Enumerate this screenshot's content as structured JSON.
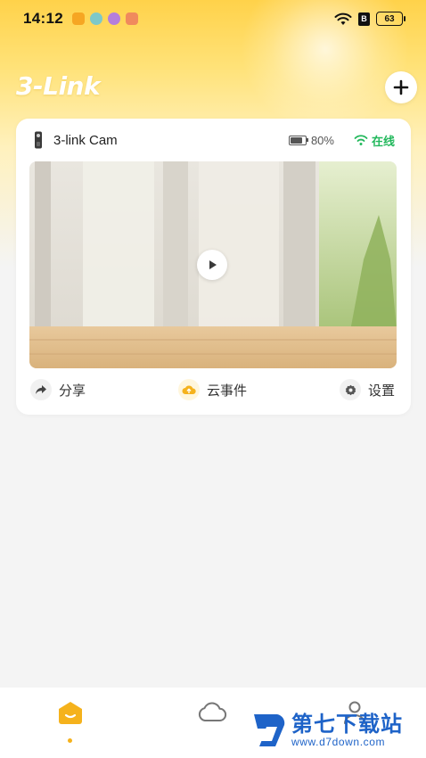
{
  "status_bar": {
    "time": "14:12",
    "battery": "63",
    "notification_icons": [
      "#f6a623",
      "#7ec8c8",
      "#b57edc",
      "#f08a5d"
    ]
  },
  "header": {
    "logo": "3-Link",
    "add_icon": "plus-icon"
  },
  "device": {
    "name": "3-link Cam",
    "battery": "80%",
    "battery_level": 0.8,
    "status": "在线",
    "status_color": "#22b85c"
  },
  "actions": {
    "share": "分享",
    "cloud_events": "云事件",
    "settings": "设置"
  },
  "tabbar": {
    "tabs": [
      "home-icon",
      "cloud-icon",
      "profile-icon"
    ],
    "active": 0,
    "accent": "#f5b21c"
  },
  "watermark": {
    "title": "第七下载站",
    "url": "www.d7down.com"
  }
}
